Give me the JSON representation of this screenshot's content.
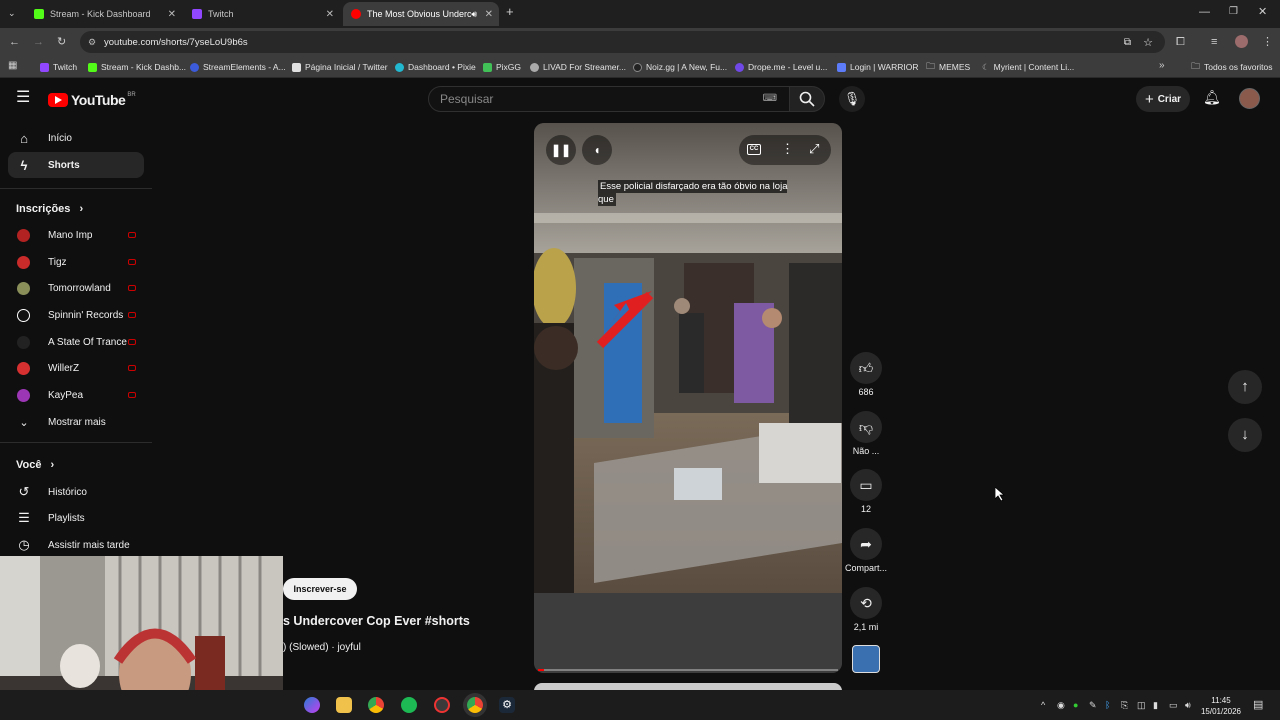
{
  "browser": {
    "tabs": [
      {
        "title": "Stream - Kick Dashboard",
        "favicon_color": "#53fc18"
      },
      {
        "title": "Twitch",
        "favicon_color": "#9146ff"
      },
      {
        "title": "The Most Obvious Underco",
        "favicon_color": "#ff0000"
      }
    ],
    "new_tab": "+",
    "address": "youtube.com/shorts/7yseLoU9b6s",
    "bookmarks": [
      {
        "label": "Twitch",
        "color": "#9146ff"
      },
      {
        "label": "Stream - Kick Dashb...",
        "color": "#53fc18"
      },
      {
        "label": "StreamElements - A...",
        "color": "#3b5bdb"
      },
      {
        "label": "Página Inicial / Twitter",
        "color": "#e0e0e0"
      },
      {
        "label": "Dashboard • Pixie",
        "color": "#22b8cf"
      },
      {
        "label": "PixGG",
        "color": "#40c057"
      },
      {
        "label": "LIVAD For Streamer...",
        "color": "#aaaaaa"
      },
      {
        "label": "Noiz.gg | A New, Fu...",
        "color": "#222222"
      },
      {
        "label": "Drope.me - Level u...",
        "color": "#7048e8"
      },
      {
        "label": "Login | WARRIOR",
        "color": "#5c7cfa"
      },
      {
        "label": "MEMES",
        "color": "#cccccc"
      },
      {
        "label": "Myrient | Content Li...",
        "color": "#888888"
      }
    ],
    "all_bookmarks": "Todos os favoritos"
  },
  "youtube": {
    "logo": "YouTube",
    "region": "BR",
    "search_placeholder": "Pesquisar",
    "create_label": "Criar"
  },
  "sidebar": {
    "home": "Início",
    "shorts": "Shorts",
    "subscriptions_header": "Inscrições",
    "channels": [
      {
        "name": "Mano Imp",
        "color": "#b22222"
      },
      {
        "name": "Tigz",
        "color": "#c92a2a"
      },
      {
        "name": "Tomorrowland",
        "color": "#8a8f5a"
      },
      {
        "name": "Spinnin' Records",
        "color": "#111111"
      },
      {
        "name": "A State Of Trance",
        "color": "#222222"
      },
      {
        "name": "WillerZ",
        "color": "#d63031"
      },
      {
        "name": "KayPea",
        "color": "#9c36b5"
      }
    ],
    "show_more": "Mostrar mais",
    "you_header": "Você",
    "history": "Histórico",
    "playlists": "Playlists",
    "watch_later": "Assistir mais tarde"
  },
  "short": {
    "caption": "Esse policial disfarçado era tão óbvio na loja que",
    "subscribe": "Inscrever-se",
    "title": "s Undercover Cop Ever #shorts",
    "music": ") (Slowed) · joyful",
    "progress": 0.02
  },
  "actions": {
    "likes": "686",
    "dislike": "Não ...",
    "comments": "12",
    "share": "Compart...",
    "remix": "2,1 mi"
  },
  "taskbar": {
    "time": "11:45",
    "date": "15/01/2026"
  }
}
